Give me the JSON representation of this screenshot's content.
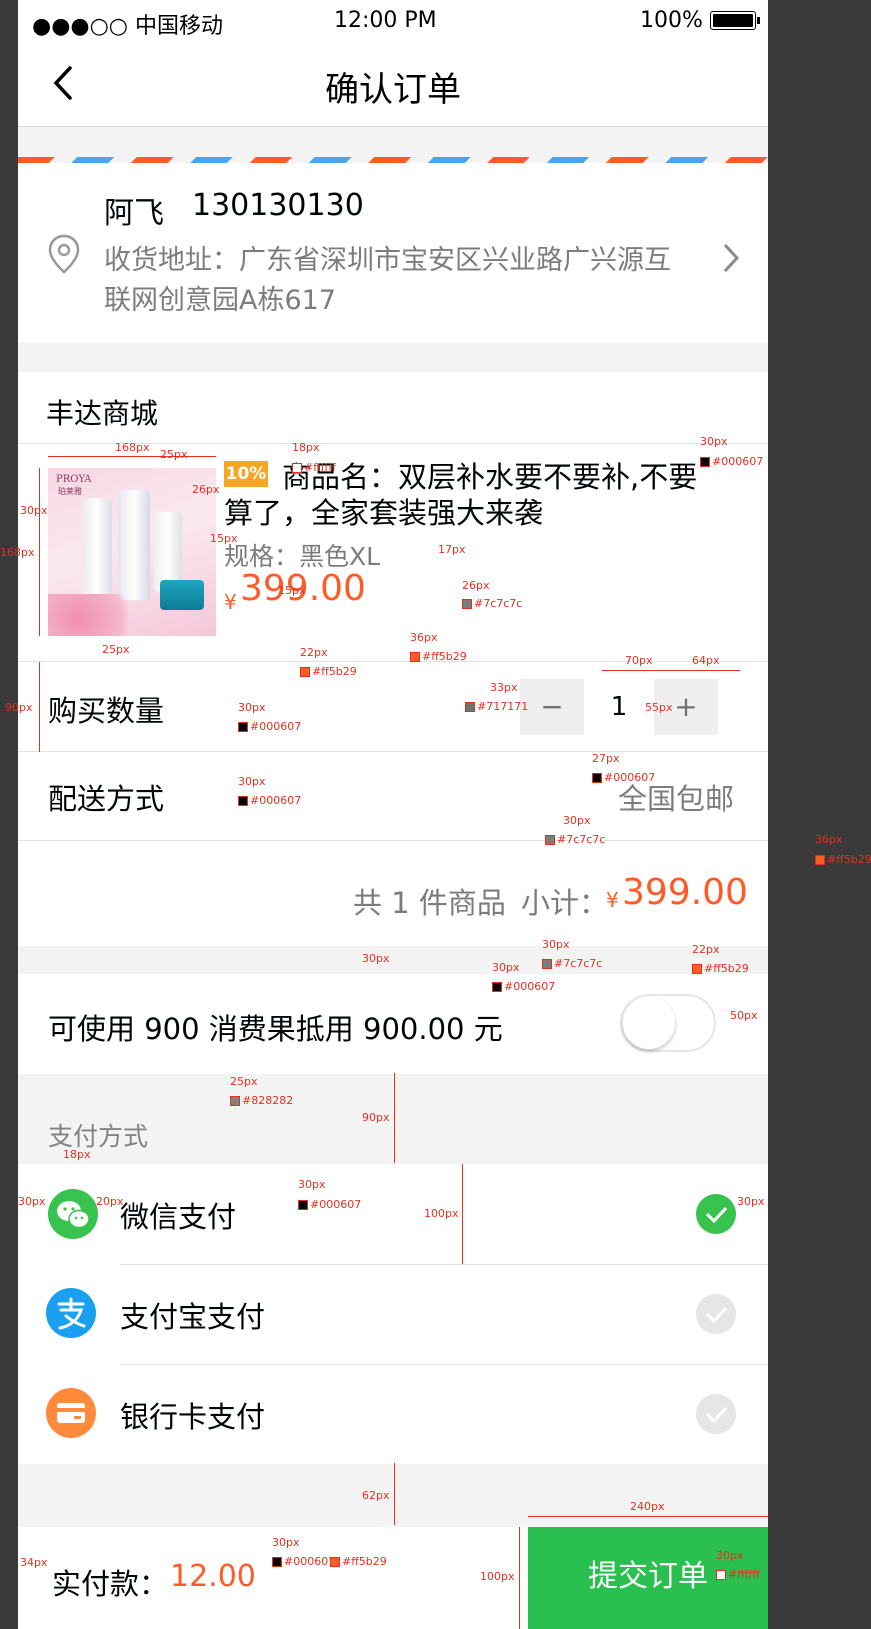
{
  "status_bar": {
    "carrier": "●●●○○ 中国移动",
    "time": "12:00 PM",
    "battery": "100%"
  },
  "nav": {
    "title": "确认订单"
  },
  "address": {
    "name": "阿飞",
    "phone": "130130130",
    "line1": "收货地址：广东省深圳市宝安区兴业路广兴源互",
    "line2": "联网创意园A栋617"
  },
  "store": {
    "name": "丰达商城"
  },
  "product": {
    "badge": "10%",
    "name_line1": "商品名：双层补水要不要补,不要",
    "name_line2": "算了，全家套装强大来袭",
    "spec": "规格：黑色XL",
    "currency": "¥",
    "price": "399.00",
    "image_brand": "PROYA",
    "image_brand_cn": "珀莱雅"
  },
  "quantity": {
    "label": "购买数量",
    "minus": "−",
    "value": "1",
    "plus": "+"
  },
  "delivery": {
    "label": "配送方式",
    "value": "全国包邮"
  },
  "subtotal": {
    "count_text": "共 1 件商品",
    "label": "小计：",
    "currency": "¥",
    "amount": "399.00"
  },
  "points": {
    "text": "可使用 900 消费果抵用 900.00 元",
    "toggle_on": false
  },
  "payment": {
    "section_title": "支付方式",
    "methods": [
      {
        "label": "微信支付",
        "icon": "wechat-icon",
        "selected": true
      },
      {
        "label": "支付宝支付",
        "icon": "alipay-icon",
        "selected": false
      },
      {
        "label": "银行卡支付",
        "icon": "bank-card-icon",
        "selected": false
      }
    ]
  },
  "footer": {
    "label": "实付款：",
    "amount": "12.00",
    "submit": "提交订单"
  },
  "colors": {
    "accent": "#ff5b29",
    "text": "#000607",
    "gray": "#7c7c7c",
    "submit_bg": "#2ac04f",
    "wechat": "#38c24e",
    "alipay": "#1aa0ee",
    "bank": "#ff8a3c"
  },
  "annotations": {
    "a1": "18px",
    "a2": "#ffffff",
    "a3": "168px",
    "a4": "25px",
    "a5": "26px",
    "a6": "30px",
    "a7": "168px",
    "a8": "15px",
    "a9": "30px",
    "a10": "#000607",
    "a11": "17px",
    "a12": "15px",
    "a13": "26px",
    "a14": "#7c7c7c",
    "a15": "36px",
    "a16": "#ff5b29",
    "a17": "22px",
    "a18": "#ff5b29",
    "a19": "25px",
    "a20": "70px",
    "a21": "64px",
    "a22": "33px",
    "a23": "#717171",
    "a24": "55px",
    "a25": "90px",
    "a26": "30px",
    "a27": "#000607",
    "a28": "27px",
    "a29": "#000607",
    "a30": "30px",
    "a31": "#000607",
    "a32": "30px",
    "a33": "#7c7c7c",
    "a34": "36px",
    "a35": "#ff5b29",
    "a36": "30px",
    "a37": "30px",
    "a38": "#7c7c7c",
    "a39": "22px",
    "a40": "#ff5b29",
    "a41": "30px",
    "a42": "#000607",
    "a43": "50px",
    "a44": "25px",
    "a45": "#828282",
    "a46": "90px",
    "a47": "18px",
    "a48": "30px",
    "a49": "20px",
    "a50": "30px",
    "a51": "#000607",
    "a52": "100px",
    "a53": "30px",
    "a54": "62px",
    "a55": "240px",
    "a56": "30px",
    "a57": "#ffffff",
    "a58": "34px",
    "a59": "30px",
    "a60": "#000607",
    "a61": "#ff5b29",
    "a62": "100px"
  }
}
